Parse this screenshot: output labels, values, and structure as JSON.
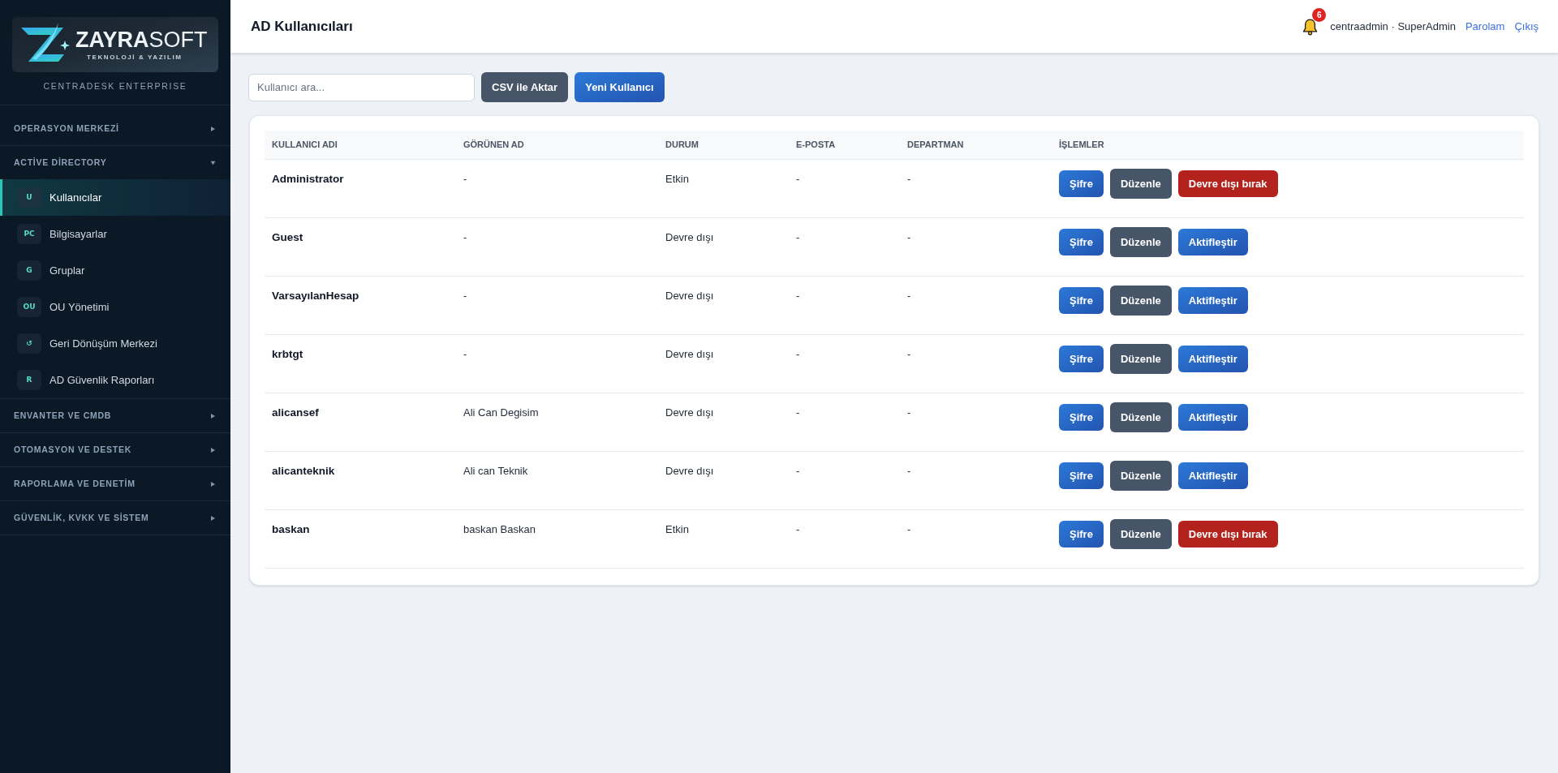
{
  "sidebar": {
    "brand": {
      "name": "**ZAYRA**SOFT",
      "tagline": "TEKNOLOJİ & YAZILIM",
      "product": "CENTRADESK ENTERPRISE"
    },
    "sections": [
      {
        "label": "OPERASYON MERKEZİ",
        "expanded": false
      },
      {
        "label": "ACTİVE DİRECTORY",
        "expanded": true,
        "items": [
          {
            "badge": "U",
            "label": "Kullanıcılar",
            "selected": true
          },
          {
            "badge": "PC",
            "label": "Bilgisayarlar",
            "selected": false
          },
          {
            "badge": "G",
            "label": "Gruplar",
            "selected": false
          },
          {
            "badge": "OU",
            "label": "OU Yönetimi",
            "selected": false
          },
          {
            "badge": "↺",
            "label": "Geri Dönüşüm Merkezi",
            "selected": false
          },
          {
            "badge": "R",
            "label": "AD Güvenlik Raporları",
            "selected": false
          }
        ]
      },
      {
        "label": "ENVANTER VE CMDB",
        "expanded": false
      },
      {
        "label": "OTOMASYON VE DESTEK",
        "expanded": false
      },
      {
        "label": "RAPORLAMA VE DENETİM",
        "expanded": false
      },
      {
        "label": "GÜVENLİK, KVKK VE SİSTEM",
        "expanded": false
      }
    ]
  },
  "header": {
    "title": "AD Kullanıcıları",
    "notifications": {
      "count": "6"
    },
    "user": "centraadmin · SuperAdmin",
    "links": [
      {
        "label": "Parolam"
      },
      {
        "label": "Çıkış"
      }
    ]
  },
  "toolbar": {
    "search": {
      "placeholder": "Kullanıcı ara..."
    },
    "buttons": [
      {
        "label": "CSV ile Aktar",
        "kind": "secondary"
      },
      {
        "label": "Yeni Kullanıcı",
        "kind": "primary"
      }
    ]
  },
  "table": {
    "columns": [
      "KULLANICI ADI",
      "GÖRÜNEN AD",
      "DURUM",
      "E-POSTA",
      "DEPARTMAN",
      "İŞLEMLER"
    ],
    "rows": [
      {
        "username": "Administrator",
        "display_name": "-",
        "status": "Etkin",
        "email": "-",
        "department": "-",
        "actions": [
          {
            "label": "Şifre",
            "kind": "primary"
          },
          {
            "label": "Düzenle",
            "kind": "secondary"
          },
          {
            "label": "Devre dışı bırak",
            "kind": "danger"
          }
        ]
      },
      {
        "username": "Guest",
        "display_name": "-",
        "status": "Devre dışı",
        "email": "-",
        "department": "-",
        "actions": [
          {
            "label": "Şifre",
            "kind": "primary"
          },
          {
            "label": "Düzenle",
            "kind": "secondary"
          },
          {
            "label": "Aktifleştir",
            "kind": "primary"
          }
        ]
      },
      {
        "username": "VarsayılanHesap",
        "display_name": "-",
        "status": "Devre dışı",
        "email": "-",
        "department": "-",
        "actions": [
          {
            "label": "Şifre",
            "kind": "primary"
          },
          {
            "label": "Düzenle",
            "kind": "secondary"
          },
          {
            "label": "Aktifleştir",
            "kind": "primary"
          }
        ]
      },
      {
        "username": "krbtgt",
        "display_name": "-",
        "status": "Devre dışı",
        "email": "-",
        "department": "-",
        "actions": [
          {
            "label": "Şifre",
            "kind": "primary"
          },
          {
            "label": "Düzenle",
            "kind": "secondary"
          },
          {
            "label": "Aktifleştir",
            "kind": "primary"
          }
        ]
      },
      {
        "username": "alicansef",
        "display_name": "Ali Can Degisim",
        "status": "Devre dışı",
        "email": "-",
        "department": "-",
        "actions": [
          {
            "label": "Şifre",
            "kind": "primary"
          },
          {
            "label": "Düzenle",
            "kind": "secondary"
          },
          {
            "label": "Aktifleştir",
            "kind": "primary"
          }
        ]
      },
      {
        "username": "alicanteknik",
        "display_name": "Ali can Teknik",
        "status": "Devre dışı",
        "email": "-",
        "department": "-",
        "actions": [
          {
            "label": "Şifre",
            "kind": "primary"
          },
          {
            "label": "Düzenle",
            "kind": "secondary"
          },
          {
            "label": "Aktifleştir",
            "kind": "primary"
          }
        ]
      },
      {
        "username": "baskan",
        "display_name": "baskan Baskan",
        "status": "Etkin",
        "email": "-",
        "department": "-",
        "actions": [
          {
            "label": "Şifre",
            "kind": "primary"
          },
          {
            "label": "Düzenle",
            "kind": "secondary"
          },
          {
            "label": "Devre dışı bırak",
            "kind": "danger"
          }
        ]
      }
    ]
  }
}
